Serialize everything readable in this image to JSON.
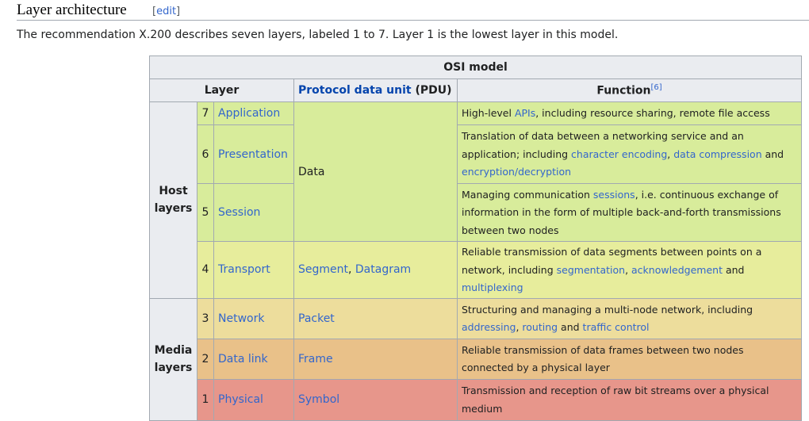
{
  "heading": {
    "title": "Layer architecture",
    "edit_open": "[",
    "edit": "edit",
    "edit_close": "]"
  },
  "intro": "The recommendation X.200 describes seven layers, labeled 1 to 7. Layer 1 is the lowest layer in this model.",
  "table": {
    "caption": "OSI model",
    "col_layer": "Layer",
    "col_pdu_link": "Protocol data unit",
    "col_pdu_suffix": " (PDU)",
    "col_function": "Function",
    "col_function_ref": "[6]",
    "group_host_1": "Host",
    "group_host_2": "layers",
    "group_media_1": "Media",
    "group_media_2": "layers",
    "pdu_data": "Data",
    "rows": [
      {
        "num": "7",
        "name": "Application",
        "f": [
          "High-level ",
          "APIs",
          ", including resource sharing, remote file access"
        ]
      },
      {
        "num": "6",
        "name": "Presentation",
        "f": [
          "Translation of data between a networking service and an application; including ",
          "character encoding",
          ", ",
          "data compression",
          " and ",
          "encryption/decryption",
          ""
        ]
      },
      {
        "num": "5",
        "name": "Session",
        "f": [
          "Managing communication ",
          "sessions",
          ", i.e. continuous exchange of information in the form of multiple back-and-forth transmissions between two nodes"
        ]
      },
      {
        "num": "4",
        "name": "Transport",
        "pdu_a": "Segment",
        "pdu_sep": ", ",
        "pdu_b": "Datagram",
        "f": [
          "Reliable transmission of data segments between points on a network, including ",
          "segmentation",
          ", ",
          "acknowledgement",
          " and ",
          "multiplexing",
          ""
        ]
      },
      {
        "num": "3",
        "name": "Network",
        "pdu": "Packet",
        "f": [
          "Structuring and managing a multi-node network, including ",
          "addressing",
          ", ",
          "routing",
          " and ",
          "traffic control",
          ""
        ]
      },
      {
        "num": "2",
        "name": "Data link",
        "pdu": "Frame",
        "f": [
          "Reliable transmission of data frames between two nodes connected by a physical layer"
        ]
      },
      {
        "num": "1",
        "name": "Physical",
        "pdu": "Symbol",
        "f": [
          "Transmission and reception of raw bit streams over a physical medium"
        ]
      }
    ]
  }
}
